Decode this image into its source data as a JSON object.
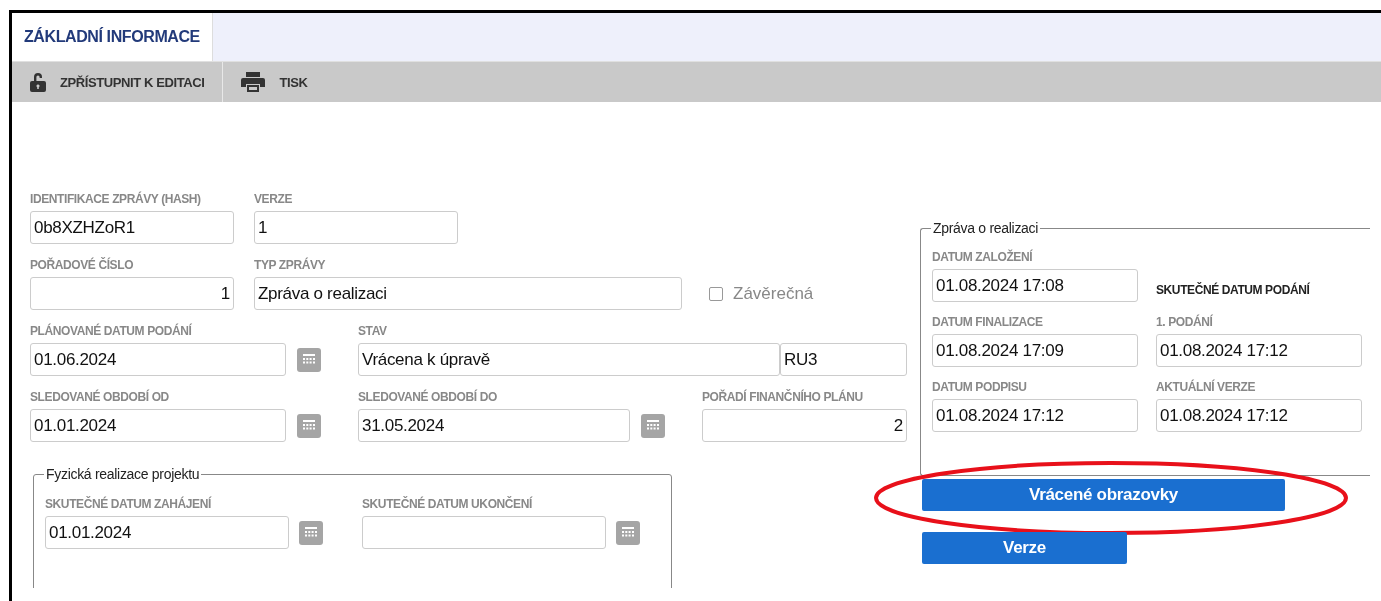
{
  "tabs": [
    {
      "label": "ZÁKLADNÍ INFORMACE",
      "selected": true
    }
  ],
  "toolbar": [
    {
      "label": "ZPŘÍSTUPNIT K EDITACI"
    },
    {
      "label": "TISK"
    }
  ],
  "form": {
    "rows": [
      [
        {
          "kind": "text",
          "label": "IDENTIFIKACE ZPRÁVY (HASH)",
          "value": "0b8XZHZoR1"
        },
        {
          "kind": "text",
          "label": "VERZE",
          "value": "1"
        }
      ],
      [
        {
          "kind": "number",
          "label": "POŘADOVÉ ČÍSLO",
          "value": "1"
        },
        {
          "kind": "text",
          "label": "TYP ZPRÁVY",
          "value": "Zpráva o realizaci"
        },
        {
          "kind": "checkbox",
          "label": "Závěrečná",
          "checked": false,
          "disabled": true
        }
      ],
      [
        {
          "kind": "date",
          "label": "PLÁNOVANÉ DATUM PODÁNÍ",
          "value": "01.06.2024"
        },
        {
          "kind": "text",
          "label": "STAV",
          "value": "Vrácena k úpravě",
          "suffix": "RU3"
        }
      ],
      [
        {
          "kind": "date",
          "label": "SLEDOVANÉ OBDOBÍ OD",
          "value": "01.01.2024"
        },
        {
          "kind": "date",
          "label": "SLEDOVANÉ OBDOBÍ DO",
          "value": "31.05.2024"
        },
        {
          "kind": "number",
          "label": "POŘADÍ FINANČNÍHO PLÁNU",
          "value": "2"
        }
      ]
    ]
  },
  "physical_realization": {
    "legend": "Fyzická realizace projektu",
    "fields": [
      {
        "kind": "date",
        "label": "SKUTEČNÉ DATUM ZAHÁJENÍ",
        "value": "01.01.2024"
      },
      {
        "kind": "date",
        "label": "SKUTEČNÉ DATUM UKONČENÍ"
      }
    ]
  },
  "report_panel": {
    "legend": "Zpráva o realizaci",
    "rows": [
      [
        {
          "kind": "text",
          "label": "DATUM ZALOŽENÍ",
          "value": "01.08.2024 17:08"
        },
        {
          "kind": "heading",
          "text": "SKUTEČNÉ DATUM PODÁNÍ"
        }
      ],
      [
        {
          "kind": "text",
          "label": "DATUM FINALIZACE",
          "value": "01.08.2024 17:09"
        },
        {
          "kind": "text",
          "label": "1. PODÁNÍ",
          "value": "01.08.2024 17:12"
        }
      ],
      [
        {
          "kind": "text",
          "label": "DATUM PODPISU",
          "value": "01.08.2024 17:12"
        },
        {
          "kind": "text",
          "label": "AKTUÁLNÍ VERZE",
          "value": "01.08.2024 17:12"
        }
      ]
    ]
  },
  "buttons": [
    {
      "label": "Vrácené obrazovky",
      "circled": true
    },
    {
      "label": "Verze",
      "circled": false
    }
  ]
}
